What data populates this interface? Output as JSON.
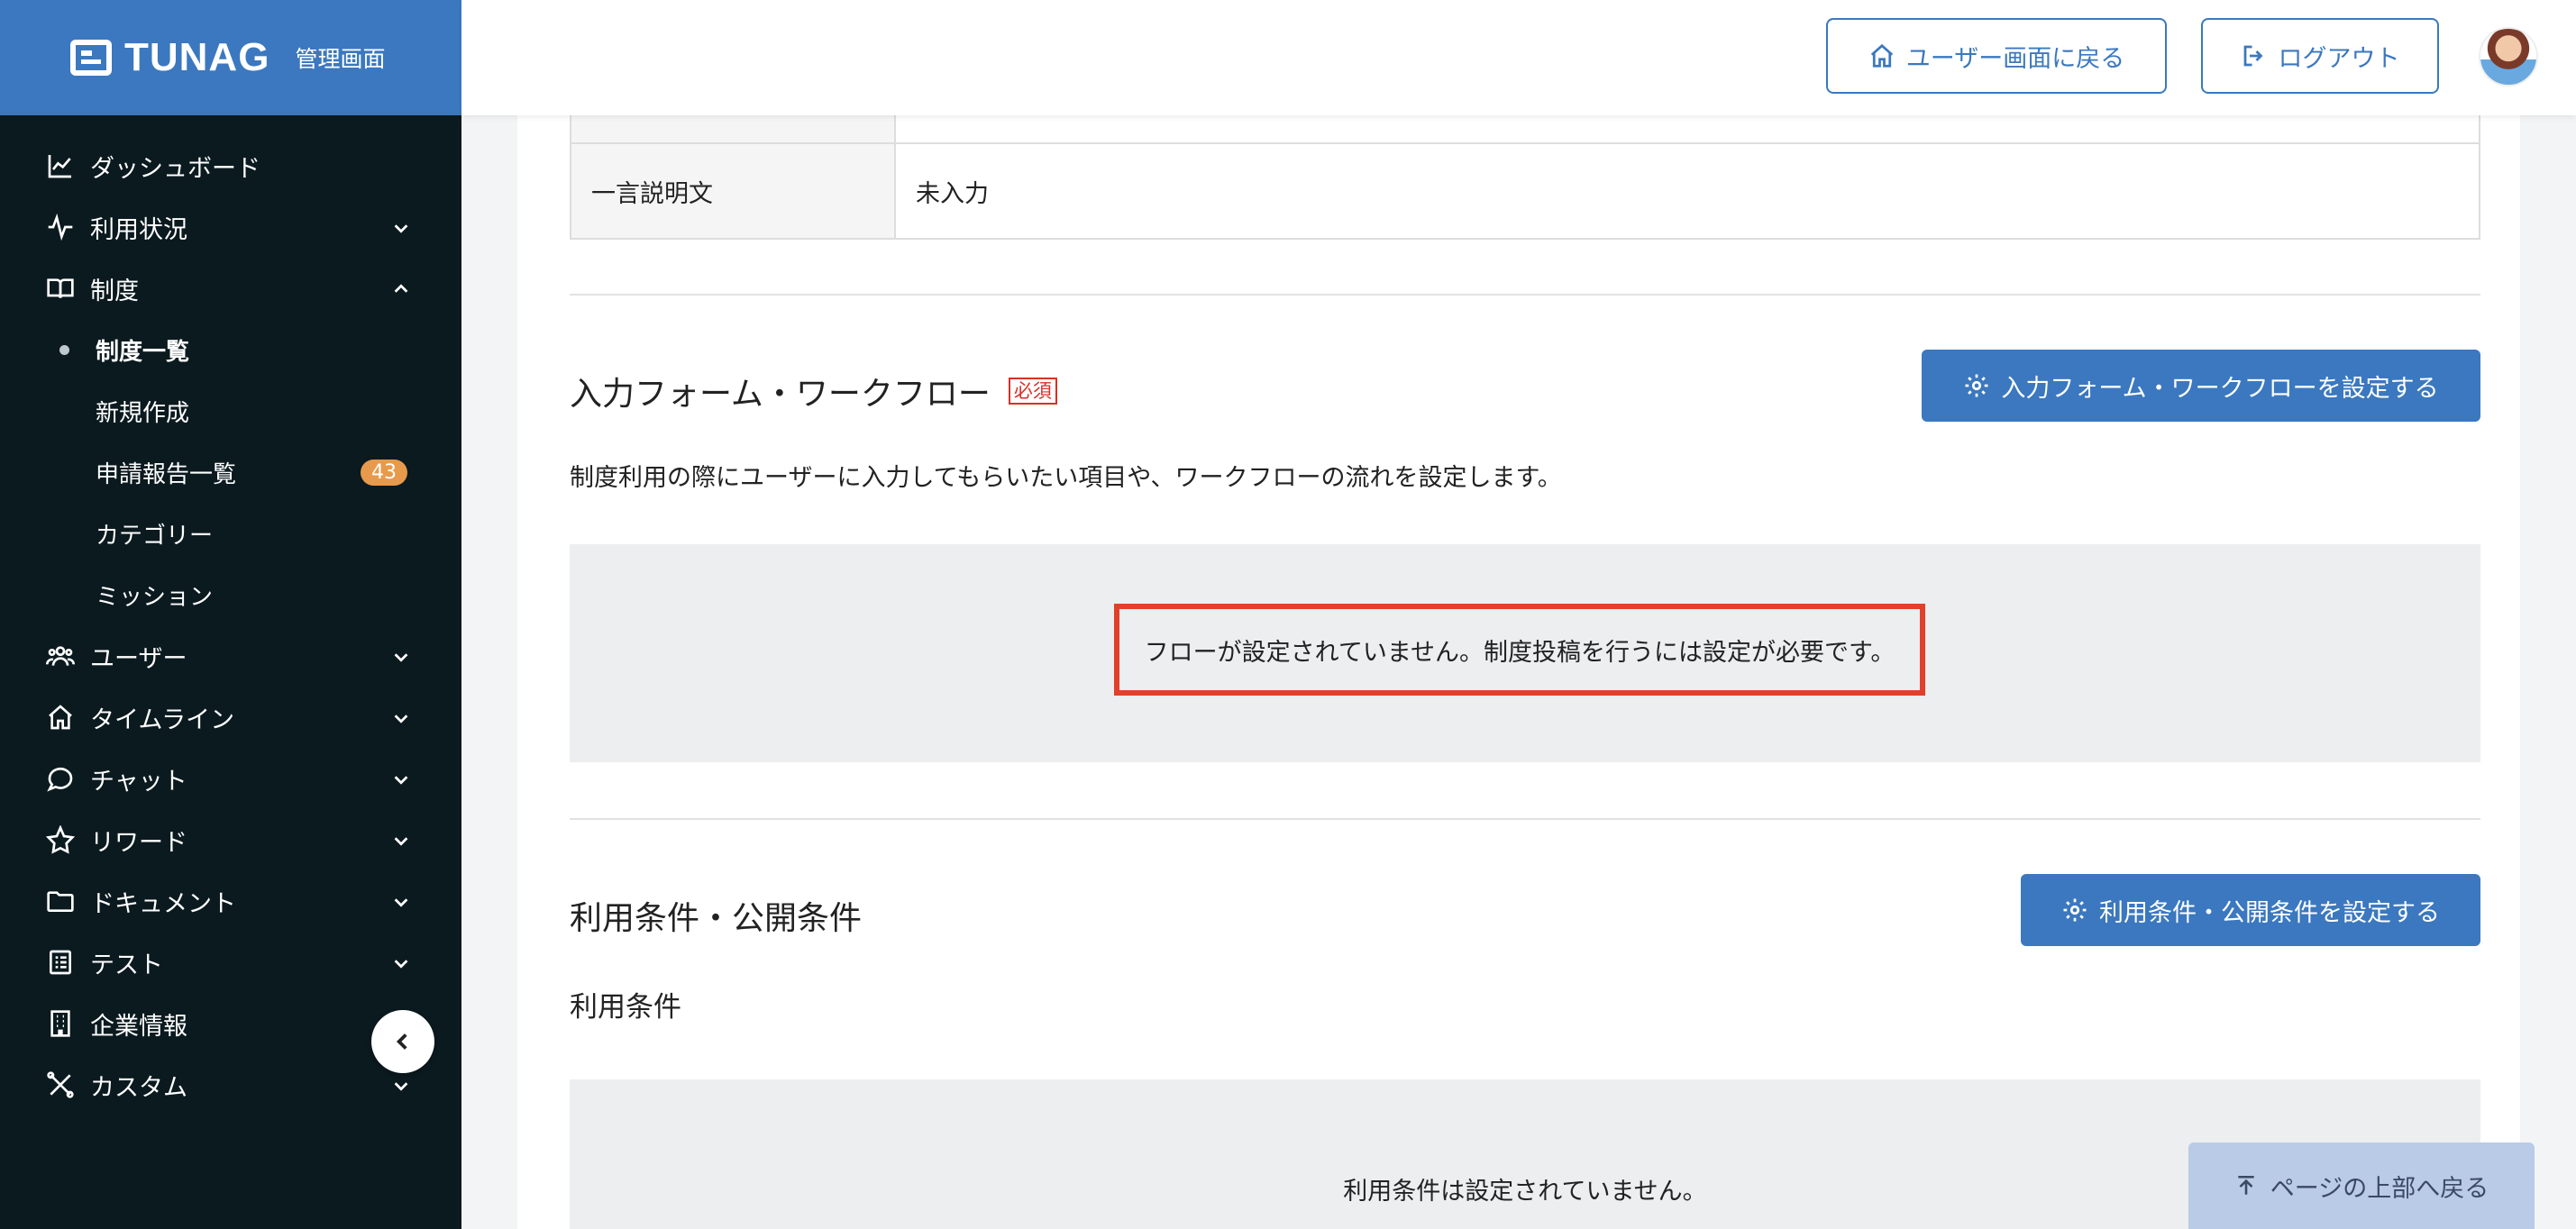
{
  "brand": {
    "logo": "TUNAG",
    "subtitle": "管理画面"
  },
  "header": {
    "user_screen_button": "ユーザー画面に戻る",
    "logout_button": "ログアウト"
  },
  "sidebar": {
    "items": [
      {
        "label": "ダッシュボード",
        "icon": "chart-icon"
      },
      {
        "label": "利用状況",
        "icon": "activity-icon"
      },
      {
        "label": "制度",
        "icon": "book-icon"
      },
      {
        "label": "ユーザー",
        "icon": "users-icon"
      },
      {
        "label": "タイムライン",
        "icon": "home-icon"
      },
      {
        "label": "チャット",
        "icon": "chat-icon"
      },
      {
        "label": "リワード",
        "icon": "star-icon"
      },
      {
        "label": "ドキュメント",
        "icon": "folder-icon"
      },
      {
        "label": "テスト",
        "icon": "checklist-icon"
      },
      {
        "label": "企業情報",
        "icon": "building-icon"
      },
      {
        "label": "カスタム",
        "icon": "tools-icon"
      }
    ],
    "subitems": [
      {
        "label": "制度一覧",
        "active": true
      },
      {
        "label": "新規作成"
      },
      {
        "label": "申請報告一覧",
        "badge": "43"
      },
      {
        "label": "カテゴリー"
      },
      {
        "label": "ミッション"
      }
    ]
  },
  "table": {
    "row_label": "一言説明文",
    "row_value": "未入力"
  },
  "form_section": {
    "title": "入力フォーム・ワークフロー",
    "required_label": "必須",
    "button": "入力フォーム・ワークフローを設定する",
    "description": "制度利用の際にユーザーに入力してもらいたい項目や、ワークフローの流れを設定します。",
    "notice": "フローが設定されていません。制度投稿を行うには設定が必要です。"
  },
  "terms_section": {
    "title": "利用条件・公開条件",
    "button": "利用条件・公開条件を設定する",
    "subtitle": "利用条件",
    "empty_text": "利用条件は設定されていません。"
  },
  "back_to_top": "ページの上部へ戻る",
  "colors": {
    "brand": "#3b78bf",
    "sidebar": "#0b1a1f",
    "notice_border": "#e2402b",
    "badge": "#e79a4c"
  }
}
